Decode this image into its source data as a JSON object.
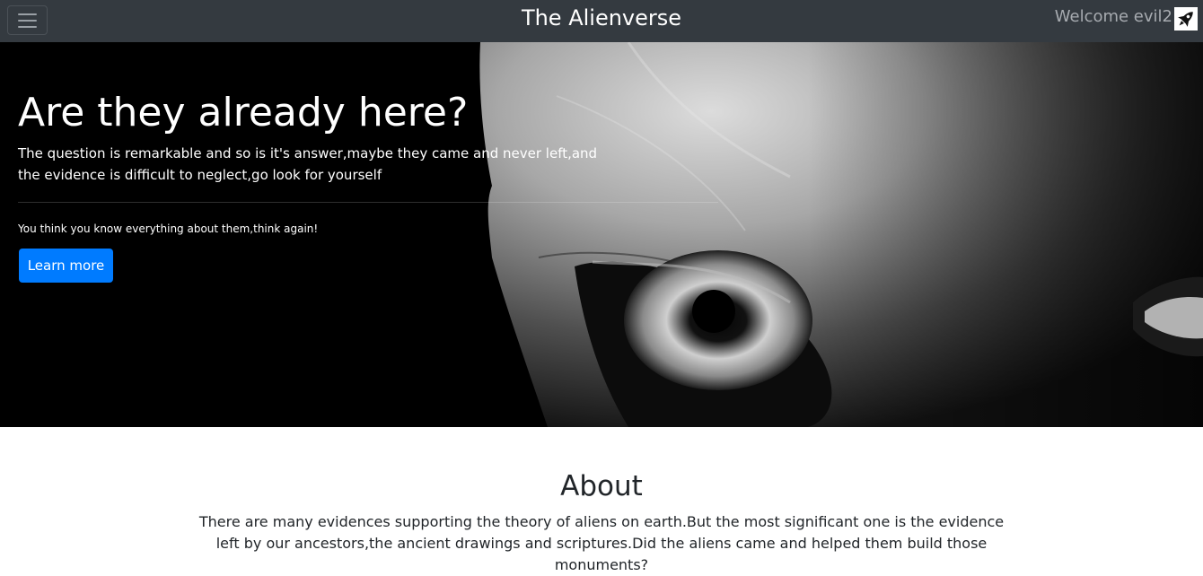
{
  "navbar": {
    "brand": "The Alienverse",
    "welcome": "Welcome evil2",
    "menu_icon": "hamburger-menu-icon",
    "user_icon": "rocket-icon"
  },
  "hero": {
    "title": "Are they already here?",
    "lead": "The question is remarkable and so is it's answer,maybe they came and never left,and the evidence is difficult to neglect,go look for yourself",
    "small": "You think you know everything about them,think again!",
    "button": "Learn more",
    "background": "alien-face-closeup"
  },
  "about": {
    "title": "About",
    "text": "There are many evidences supporting the theory of aliens on earth.But the most significant one is the evidence left by our ancestors,the ancient drawings and scriptures.Did the aliens came and helped them build those monuments?"
  },
  "colors": {
    "navbar": "#343a40",
    "primary_button": "#007bff",
    "hero_background": "#000000"
  }
}
